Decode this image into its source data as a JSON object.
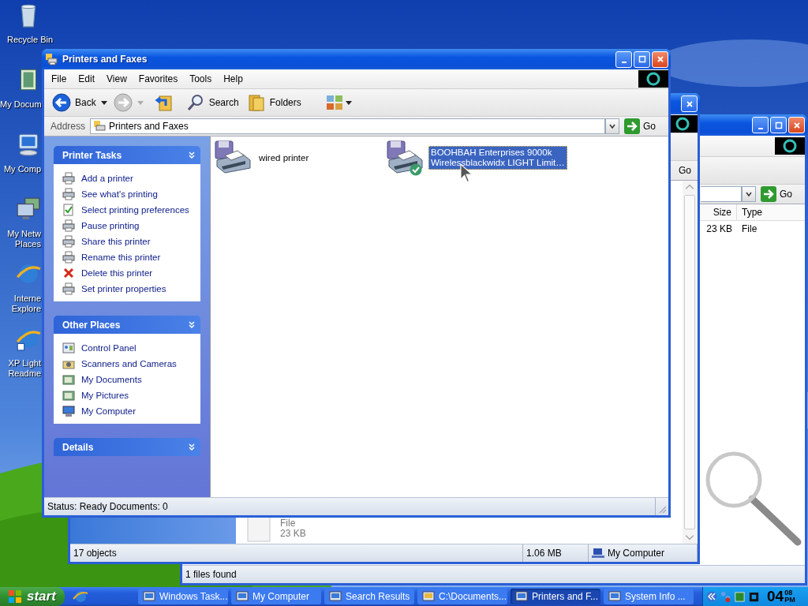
{
  "desktop_icons": [
    {
      "lines": [
        "Recycle Bin"
      ]
    },
    {
      "lines": [
        "My Docum"
      ]
    },
    {
      "lines": [
        "My Comp"
      ]
    },
    {
      "lines": [
        "My Netw",
        "Places"
      ]
    },
    {
      "lines": [
        "Interne",
        "Explore"
      ]
    },
    {
      "lines": [
        "XP Light",
        "Readme"
      ]
    }
  ],
  "search_window": {
    "go": "Go",
    "columns": [
      "Size",
      "Type"
    ],
    "rows": [
      [
        "23 KB",
        "File"
      ]
    ],
    "status": "1 files found"
  },
  "computer_window": {
    "go": "Go",
    "file": {
      "type": "File",
      "size": "23 KB"
    },
    "status": {
      "objects": "17 objects",
      "size": "1.06 MB",
      "zone": "My Computer"
    }
  },
  "main_window": {
    "title": "Printers and Faxes",
    "menu": [
      "File",
      "Edit",
      "View",
      "Favorites",
      "Tools",
      "Help"
    ],
    "toolbar": {
      "back": "Back",
      "search": "Search",
      "folders": "Folders"
    },
    "address": {
      "label": "Address",
      "value": "Printers and Faxes",
      "go": "Go"
    },
    "panels": [
      {
        "title": "Printer Tasks",
        "items": [
          "Add a printer",
          "See what's printing",
          "Select printing preferences",
          "Pause printing",
          "Share this printer",
          "Rename this printer",
          "Delete this printer",
          "Set printer properties"
        ]
      },
      {
        "title": "Other Places",
        "items": [
          "Control Panel",
          "Scanners and Cameras",
          "My Documents",
          "My Pictures",
          "My Computer"
        ]
      },
      {
        "title": "Details"
      }
    ],
    "printers": [
      {
        "name_lines": [
          "wired printer"
        ],
        "selected": false,
        "default": false
      },
      {
        "name_lines": [
          "BOOHBAH Enterprises 9000k",
          "Wirelessblackwidx LIGHT Limit…"
        ],
        "selected": true,
        "default": true
      }
    ],
    "status": "Status: Ready Documents: 0"
  },
  "taskbar": {
    "start": "start",
    "tasks": [
      {
        "label": "Windows Task...",
        "selected": false
      },
      {
        "label": "My Computer",
        "selected": false
      },
      {
        "label": "Search Results",
        "selected": false
      },
      {
        "label": "C:\\Documents...",
        "selected": false
      },
      {
        "label": "Printers and F...",
        "selected": true
      },
      {
        "label": "System Info ...",
        "selected": false
      }
    ],
    "clock": {
      "hour": "04",
      "minute": "08",
      "period": "PM"
    }
  }
}
